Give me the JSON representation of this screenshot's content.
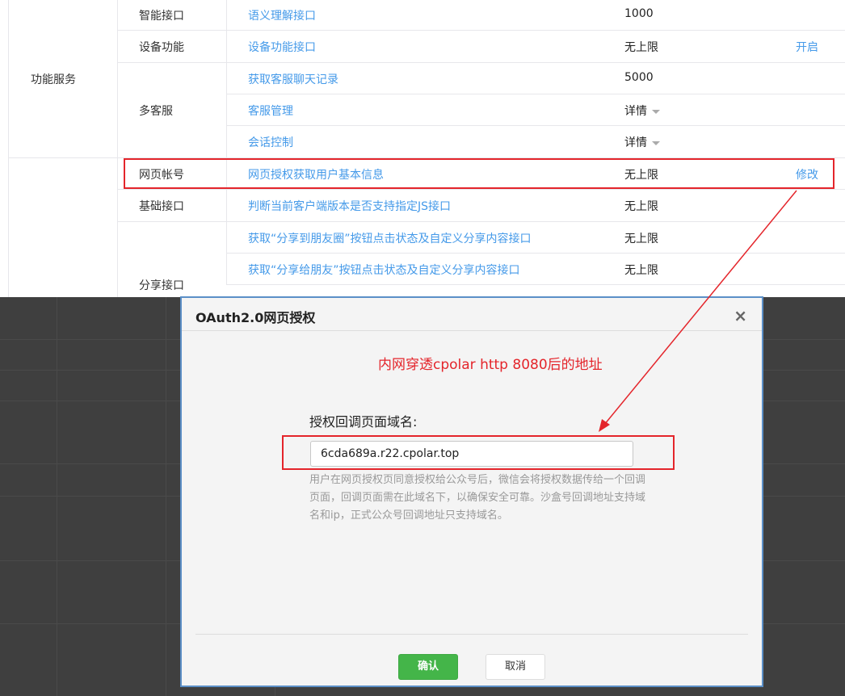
{
  "table": {
    "categories": [
      {
        "label": "功能服务"
      },
      {
        "label": ""
      }
    ],
    "groups": [
      {
        "label": "智能接口"
      },
      {
        "label": "设备功能"
      },
      {
        "label": "多客服"
      },
      {
        "label": "网页帐号"
      },
      {
        "label": "基础接口"
      },
      {
        "label": "分享接口"
      }
    ],
    "rows": [
      {
        "name": "语义理解接口",
        "limit": "1000",
        "action": ""
      },
      {
        "name": "设备功能接口",
        "limit": "无上限",
        "action": "开启"
      },
      {
        "name": "获取客服聊天记录",
        "limit": "5000",
        "action": ""
      },
      {
        "name": "客服管理",
        "limit": "详情",
        "action": ""
      },
      {
        "name": "会话控制",
        "limit": "详情",
        "action": ""
      },
      {
        "name": "网页授权获取用户基本信息",
        "limit": "无上限",
        "action": "修改"
      },
      {
        "name": "判断当前客户端版本是否支持指定JS接口",
        "limit": "无上限",
        "action": ""
      },
      {
        "name": "获取“分享到朋友圈”按钮点击状态及自定义分享内容接口",
        "limit": "无上限",
        "action": ""
      },
      {
        "name": "获取“分享给朋友”按钮点击状态及自定义分享内容接口",
        "limit": "无上限",
        "action": ""
      }
    ]
  },
  "dialog": {
    "title": "OAuth2.0网页授权",
    "close": "×",
    "annotation": "内网穿透cpolar http 8080后的地址",
    "field_label": "授权回调页面域名:",
    "field_value": "6cda689a.r22.cpolar.top",
    "help": "用户在网页授权页同意授权给公众号后，微信会将授权数据传给一个回调页面，回调页面需在此域名下，以确保安全可靠。沙盒号回调地址支持域名和ip，正式公众号回调地址只支持域名。",
    "ok_label": "确认",
    "cancel_label": "取消"
  },
  "colors": {
    "link": "#459ae9",
    "highlight": "#e4252b",
    "ok": "#44b549"
  }
}
